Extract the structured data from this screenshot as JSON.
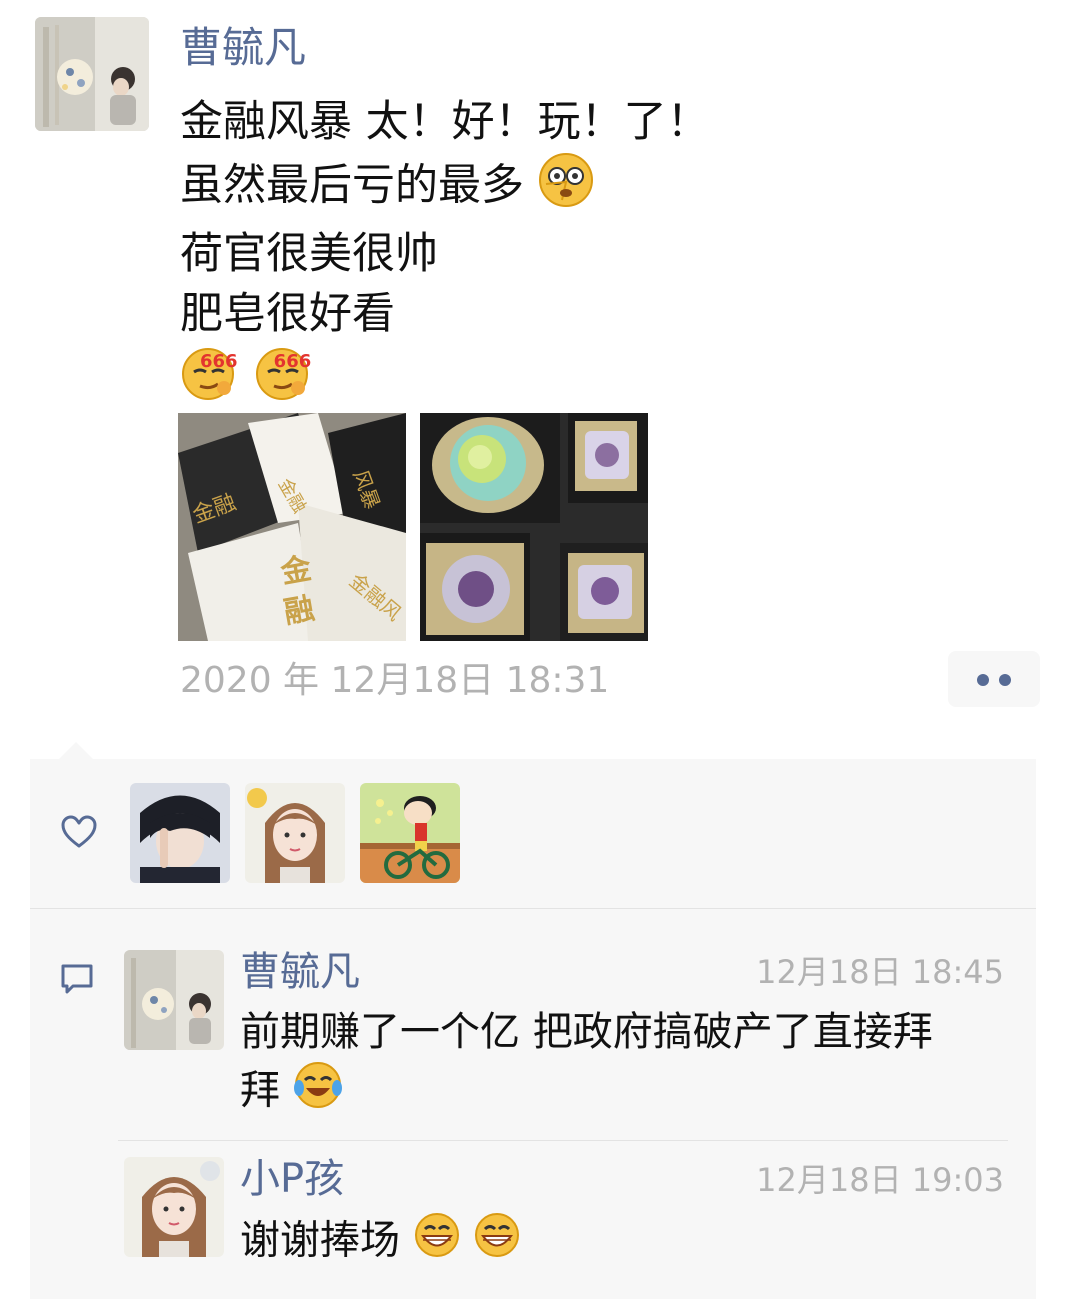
{
  "post": {
    "author": "曹毓凡",
    "lines": [
      "金融风暴 太！好！玩！了！",
      "虽然最后亏的最多",
      "荷官很美很帅",
      "肥皂很好看"
    ],
    "emoji_line1_after": "dizzy-face-emoji",
    "emoji_666": "666",
    "photos": [
      {
        "icon": "financial-storm-cards-photo"
      },
      {
        "icon": "soap-gift-boxes-photo"
      }
    ],
    "timestamp": "2020 年 12月18日 18:31",
    "more_icon": "two-dots-icon"
  },
  "likes": {
    "icon": "heart-icon",
    "avatars": [
      "avatar-dark-hair-boy",
      "avatar-girl-brown-hair",
      "avatar-crayon-shin-chan-bicycle"
    ]
  },
  "comments": {
    "icon": "comment-bubble-icon",
    "items": [
      {
        "name": "曹毓凡",
        "time": "12月18日 18:45",
        "text_line1": "前期赚了一个亿 把政府搞破产了直接拜",
        "text_line2": "拜",
        "emoji": "crying-laughing-emoji"
      },
      {
        "name": "小P孩",
        "time": "12月18日 19:03",
        "text": "谢谢捧场",
        "emoji": "grinning-emoji"
      }
    ]
  },
  "colors": {
    "link": "#576b95",
    "panel": "#f7f7f7",
    "timestamp": "#b2b2b2",
    "text": "#111111"
  }
}
